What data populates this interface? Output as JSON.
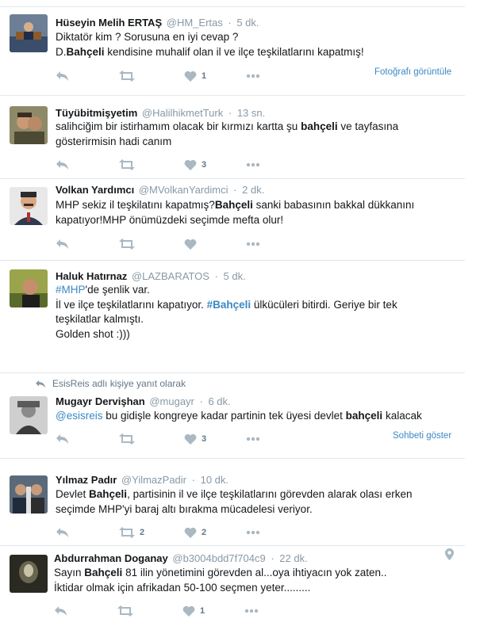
{
  "colors": {
    "link": "#3b88c3",
    "muted": "#8899a6",
    "icon": "#aab8c2",
    "separator": "#e1e8ed"
  },
  "tweets": [
    {
      "fullname": "Hüseyin Melih ERTAŞ",
      "username": "@HM_Ertas",
      "time": "5 dk.",
      "lines": [
        "Diktatör kim ? Sorusuna en iyi cevap ?",
        "D.",
        "Bahçeli",
        " kendisine muhalif olan il ve ilçe teşkilatlarını kapatmış!"
      ],
      "retweets": "",
      "likes": "1",
      "side_link": "Fotoğrafı görüntüle"
    },
    {
      "fullname": "Tüyübitmişyetim",
      "username": "@HalilhikmetTurk",
      "time": "13 sn.",
      "lines": [
        "salihciğim bir istirhamım olacak bir kırmızı kartta şu ",
        "bahçeli",
        " ve tayfasına",
        "gösterirmisin  hadi canım"
      ],
      "retweets": "",
      "likes": "3"
    },
    {
      "fullname": "Volkan Yardımcı",
      "username": "@MVolkanYardimci",
      "time": "2 dk.",
      "lines": [
        "MHP  sekiz il teşkilatını kapatmış?",
        "Bahçeli",
        " sanki babasının bakkal dükkanını",
        "kapatıyor!MHP önümüzdeki seçimde mefta olur!"
      ],
      "retweets": "",
      "likes": ""
    },
    {
      "fullname": "Haluk Hatırnaz",
      "username": "@LAZBARATOS",
      "time": "5 dk.",
      "lines": [
        "#MHP",
        "'de şenlik var.",
        "İl ve ilçe teşkilatlarını kapatıyor. ",
        "#Bahçeli",
        " ülkücüleri bitirdi. Geriye bir tek",
        "teşkilatlar kalmıştı.",
        "Golden shot :)))"
      ],
      "retweets": "",
      "likes": ""
    },
    {
      "context": "EsisReis adlı kişiye yanıt olarak",
      "fullname": "Mugayr Dervişhan",
      "username": "@mugayr",
      "time": "6 dk.",
      "lines": [
        "@esisreis",
        " bu gidişle kongreye kadar partinin tek üyesi devlet ",
        "bahçeli",
        " kalacak"
      ],
      "retweets": "",
      "likes": "3",
      "side_link": "Sohbeti göster"
    },
    {
      "fullname": "Yılmaz Padır",
      "username": "@YilmazPadir",
      "time": "10 dk.",
      "lines": [
        "Devlet ",
        "Bahçeli",
        ", partisinin il ve ilçe teşkilatlarını görevden alarak olası erken",
        "seçimde MHP'yi baraj altı bırakma mücadelesi veriyor."
      ],
      "retweets": "2",
      "likes": "2"
    },
    {
      "fullname": "Abdurrahman Doganay",
      "username": "@b3004bdd7f704c9",
      "time": "22 dk.",
      "lines": [
        "Sayın ",
        "Bahçeli",
        " 81 ilin yönetimini görevden al...oya ihtiyacın yok zaten..",
        "İktidar olmak için afrikadan 50-100 seçmen yeter........."
      ],
      "retweets": "",
      "likes": "1"
    }
  ]
}
